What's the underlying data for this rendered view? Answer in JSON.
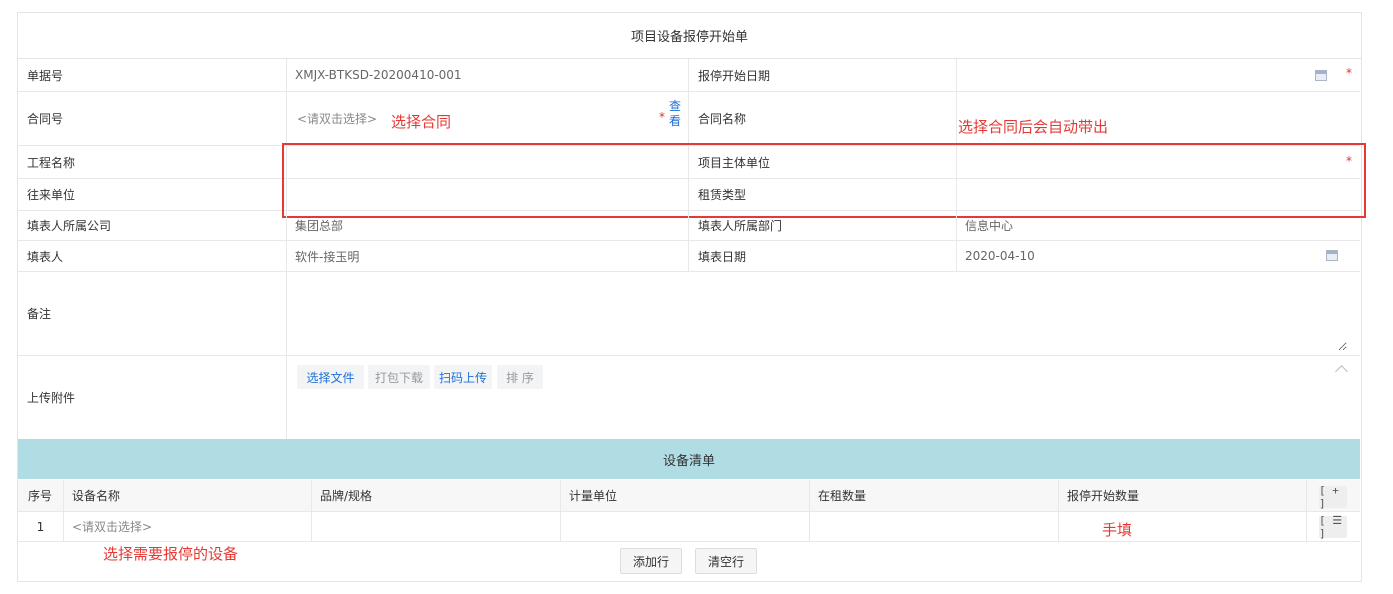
{
  "form_title": "项目设备报停开始单",
  "fields": {
    "doc_no": {
      "label": "单据号",
      "value": "XMJX-BTKSD-20200410-001"
    },
    "stop_start_date": {
      "label": "报停开始日期",
      "value": ""
    },
    "contract_no": {
      "label": "合同号",
      "placeholder": "<请双击选择>",
      "view_link": "查看"
    },
    "contract_name": {
      "label": "合同名称",
      "value": ""
    },
    "project_name": {
      "label": "工程名称",
      "value": ""
    },
    "project_main_unit": {
      "label": "项目主体单位",
      "value": ""
    },
    "counterparty": {
      "label": "往来单位",
      "value": ""
    },
    "lease_type": {
      "label": "租赁类型",
      "value": ""
    },
    "filler_company": {
      "label": "填表人所属公司",
      "value": "集团总部"
    },
    "filler_dept": {
      "label": "填表人所属部门",
      "value": "信息中心"
    },
    "filler": {
      "label": "填表人",
      "value": "软件-接玉明"
    },
    "fill_date": {
      "label": "填表日期",
      "value": "2020-04-10"
    },
    "remark": {
      "label": "备注",
      "value": ""
    },
    "attachments": {
      "label": "上传附件"
    }
  },
  "required_mark": "*",
  "attach_buttons": {
    "choose": "选择文件",
    "pack_download": "打包下载",
    "scan_upload": "扫码上传",
    "sort": "排 序"
  },
  "annotations": {
    "choose_contract": "选择合同",
    "auto_fill": "选择合同后会自动带出",
    "choose_equipment": "选择需要报停的设备",
    "manual": "手填"
  },
  "equipment": {
    "title": "设备清单",
    "columns": [
      "序号",
      "设备名称",
      "品牌/规格",
      "计量单位",
      "在租数量",
      "报停开始数量"
    ],
    "rows": [
      {
        "no": "1",
        "name_placeholder": "<请双击选择>",
        "brand": "",
        "unit": "",
        "qty": "",
        "stop_qty": ""
      }
    ],
    "add_icon": "[ + ]",
    "menu_icon": "[ ☰ ]",
    "add_row": "添加行",
    "clear_rows": "清空行"
  },
  "colors": {
    "section_bg": "#b0dde4",
    "annotation": "#e53935",
    "link": "#1e6fd9"
  }
}
